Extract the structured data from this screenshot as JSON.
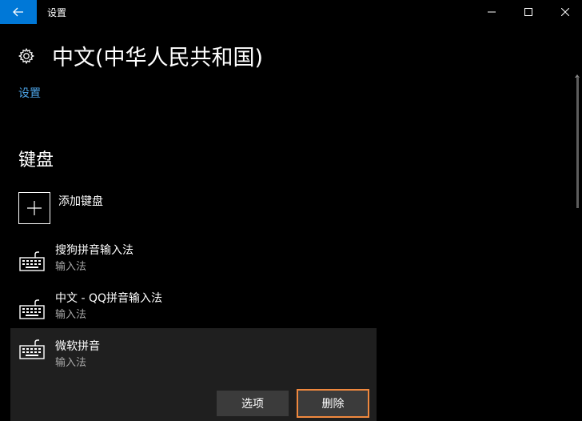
{
  "window": {
    "title": "设置",
    "accent": "#0078d7"
  },
  "header": {
    "title": "中文(中华人民共和国)",
    "icon": "gear-icon"
  },
  "links": {
    "settings": "设置"
  },
  "keyboard_section": {
    "title": "键盘",
    "add_label": "添加键盘",
    "items": [
      {
        "name": "搜狗拼音输入法",
        "sub": "输入法"
      },
      {
        "name": "中文 - QQ拼音输入法",
        "sub": "输入法"
      },
      {
        "name": "微软拼音",
        "sub": "输入法",
        "selected": true
      }
    ],
    "options_label": "选项",
    "delete_label": "删除"
  },
  "colors": {
    "link": "#4ca3e6",
    "highlight_border": "#f0883e",
    "selected_bg": "#1f1f1f"
  }
}
